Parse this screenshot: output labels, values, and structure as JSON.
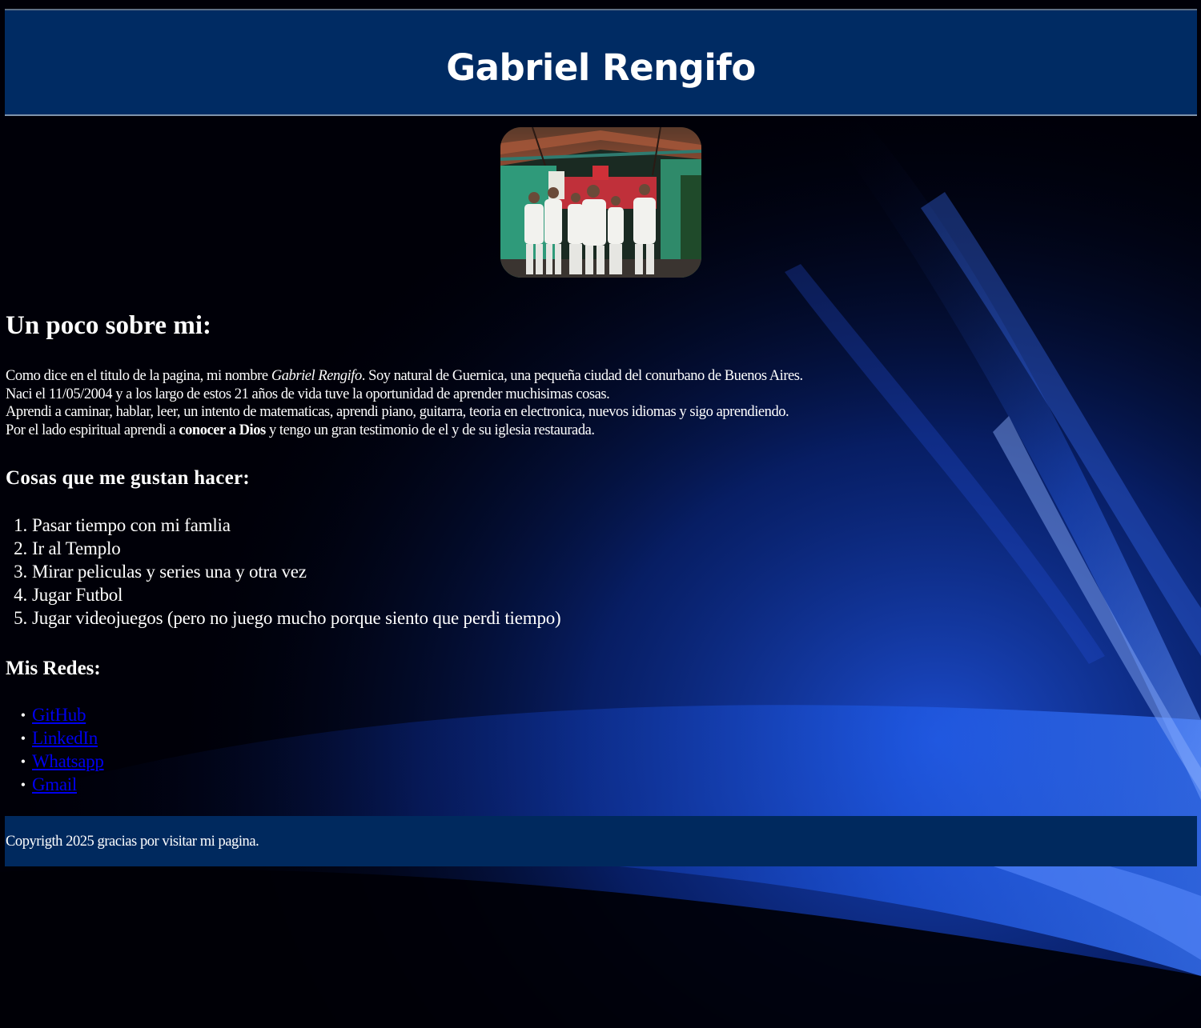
{
  "header": {
    "title": "Gabriel Rengifo"
  },
  "profile_photo": {
    "description_icon": "group-photo"
  },
  "about": {
    "heading": "Un poco sobre mi:",
    "line1_a": "Como dice en el titulo de la pagina, mi nombre ",
    "line1_name": "Gabriel Rengifo",
    "line1_b": ". Soy natural de Guernica, una pequeña ciudad del conurbano de Buenos Aires.",
    "line2": "Naci el 11/05/2004 y a los largo de estos 21 años de vida tuve la oportunidad de aprender muchisimas cosas.",
    "line3": "Aprendi a caminar, hablar, leer, un intento de matematicas, aprendi piano, guitarra, teoria en electronica, nuevos idiomas y sigo aprendiendo.",
    "line4_a": "Por el lado espiritual aprendi a ",
    "line4_bold": "conocer a Dios",
    "line4_b": " y tengo un gran testimonio de el y de su iglesia restaurada."
  },
  "likes": {
    "heading": "Cosas que me gustan hacer:",
    "items": [
      {
        "num": "1.",
        "text": "Pasar tiempo con mi famlia"
      },
      {
        "num": "2.",
        "text": "Ir al Templo"
      },
      {
        "num": "3.",
        "text": "Mirar peliculas y series una y otra vez"
      },
      {
        "num": "4.",
        "text": "Jugar Futbol"
      },
      {
        "num": "5.",
        "text": "Jugar videojuegos (pero no juego mucho porque siento que perdi tiempo)"
      }
    ]
  },
  "redes": {
    "heading": "Mis Redes:",
    "bullet": "•",
    "links": [
      {
        "label": "GitHub"
      },
      {
        "label": "LinkedIn"
      },
      {
        "label": "Whatsapp"
      },
      {
        "label": "Gmail"
      }
    ],
    "link_color": "#0000ee"
  },
  "footer": {
    "text": "Copyrigth 2025 gracias por visitar mi pagina."
  },
  "colors": {
    "header_bg": "#002b63",
    "footer_bg": "#00295e",
    "page_bg": "#000008",
    "accent_blue": "#1a4fd1"
  }
}
